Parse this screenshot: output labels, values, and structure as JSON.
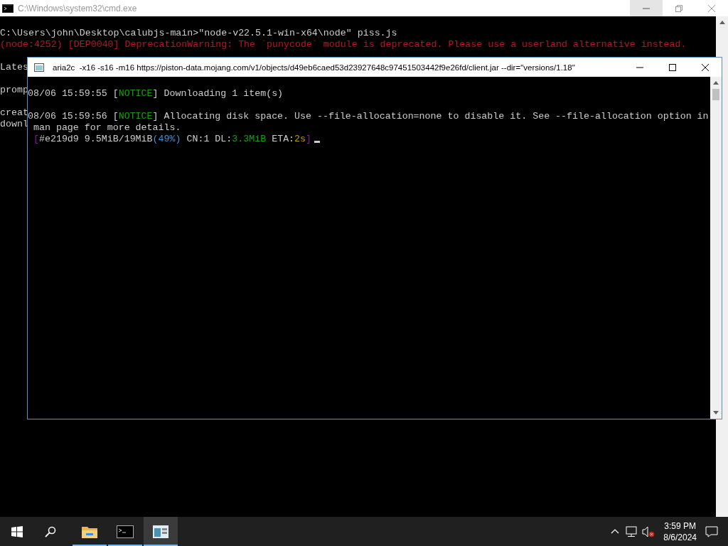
{
  "back_window": {
    "title": "C:\\Windows\\system32\\cmd.exe",
    "blocks": [
      [
        [
          {
            "kind": "plain",
            "text": "C:\\Users\\john\\Desktop\\calubjs-main>\"node-v22.5.1-win-x64\\node\" piss.js"
          }
        ],
        [
          {
            "kind": "warning",
            "text": "(node:4252) [DEP0040] DeprecationWarning: The `punycode` module is deprecated. Please use a userland alternative instead."
          }
        ]
      ],
      [
        [
          {
            "kind": "plain",
            "text": "Lates"
          }
        ]
      ],
      [
        [
          {
            "kind": "plain",
            "text": "promp"
          }
        ]
      ],
      [
        [
          {
            "kind": "plain",
            "text": "creat"
          }
        ],
        [
          {
            "kind": "plain",
            "text": "downl"
          }
        ]
      ]
    ]
  },
  "front_window": {
    "title": "aria2c  -x16 -s16 -m16 https://piston-data.mojang.com/v1/objects/d49eb6caed53d23927648c97451503442f9e26fd/client.jar --dir=\"versions/1.18\"",
    "blocks": [
      [
        [
          {
            "kind": "plain",
            "text": "08/06 15:59:55 ["
          },
          {
            "kind": "notice",
            "text": "NOTICE"
          },
          {
            "kind": "plain",
            "text": "] Downloading 1 item(s)"
          }
        ]
      ],
      [
        [
          {
            "kind": "plain",
            "text": "08/06 15:59:56 ["
          },
          {
            "kind": "notice",
            "text": "NOTICE"
          },
          {
            "kind": "plain",
            "text": "] Allocating disk space. Use --file-allocation=none to disable it. See --file-allocation option in"
          }
        ],
        [
          {
            "kind": "plain",
            "text": " man page for more details."
          }
        ],
        [
          {
            "kind": "bracket",
            "text": " ["
          },
          {
            "kind": "plain",
            "text": "#e219d9 9.5MiB/19MiB"
          },
          {
            "kind": "percent",
            "text": "(49%)"
          },
          {
            "kind": "plain",
            "text": " CN:1 DL:"
          },
          {
            "kind": "speed",
            "text": "3.3MiB"
          },
          {
            "kind": "plain",
            "text": " ETA:"
          },
          {
            "kind": "eta",
            "text": "2s"
          },
          {
            "kind": "bracket",
            "text": "]"
          }
        ]
      ]
    ]
  },
  "taskbar": {
    "apps": [
      {
        "kind": "folder",
        "running": true,
        "selected": false
      },
      {
        "kind": "console",
        "running": true,
        "selected": false
      },
      {
        "kind": "window",
        "running": true,
        "selected": true
      }
    ],
    "time": "3:59 PM",
    "date": "8/6/2024"
  }
}
